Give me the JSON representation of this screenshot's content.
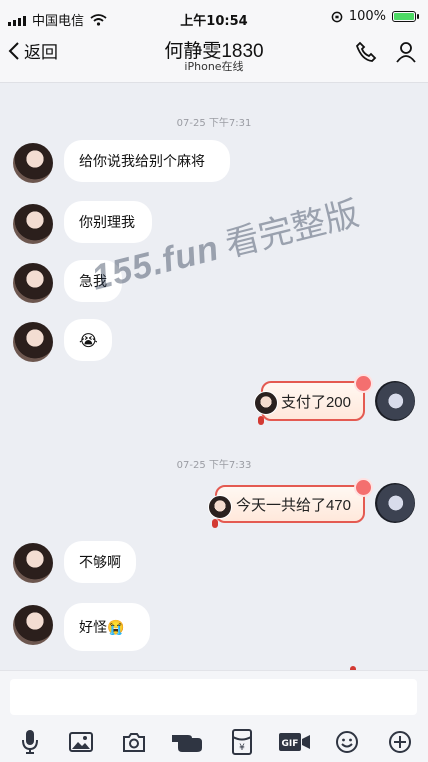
{
  "status_bar": {
    "carrier": "中国电信",
    "time": "上午10:54",
    "battery": "100%",
    "battery_level": 1.0
  },
  "nav": {
    "back_label": "返回",
    "title": "何静雯1830",
    "subtitle": "iPhone在线"
  },
  "messages": {
    "time_1": "07-25 下午7:31",
    "msg_1": "给你说我给别个麻将",
    "msg_2": "你别理我",
    "msg_3": "急我",
    "msg_4": "😭",
    "msg_5": "支付了200",
    "time_2": "07-25 下午7:33",
    "msg_6": "今天一共给了470",
    "msg_7": "不够啊",
    "msg_8": "好怪😭"
  },
  "watermark": {
    "part_1": "155.fun",
    "part_2": "看完整版"
  },
  "input": {
    "placeholder": ""
  },
  "toolbar": {
    "icons": [
      "microphone-icon",
      "image-icon",
      "camera-icon",
      "hand-icon",
      "red-packet-icon",
      "gif-icon",
      "emoji-icon",
      "plus-icon"
    ],
    "red_packet_symbol": "¥",
    "gif_label": "GIF"
  },
  "colors": {
    "background": "#eceef3",
    "bubble": "#ffffff",
    "red_border": "#e45a51",
    "text": "#111111"
  }
}
